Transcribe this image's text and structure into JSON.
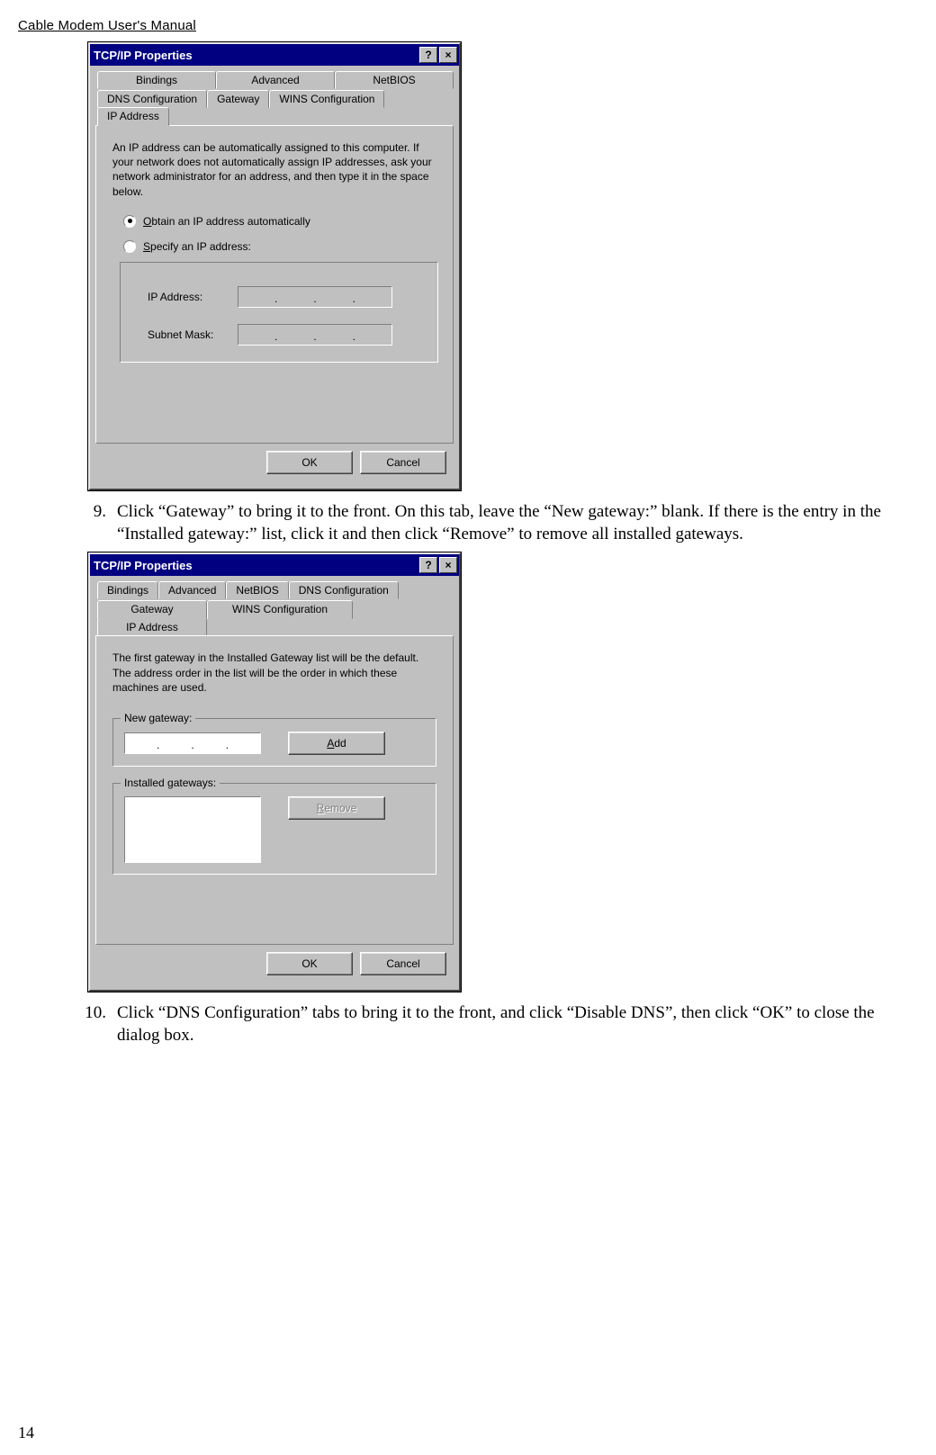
{
  "header": {
    "running_head": "Cable Modem User's Manual"
  },
  "page_number": "14",
  "dlg1": {
    "title": "TCP/IP Properties",
    "help_btn": "?",
    "close_btn": "×",
    "tabs_row1": {
      "bindings": "Bindings",
      "advanced": "Advanced",
      "netbios": "NetBIOS"
    },
    "tabs_row2": {
      "dns": "DNS Configuration",
      "gateway": "Gateway",
      "wins": "WINS Configuration",
      "ip": "IP Address"
    },
    "help_text": "An IP address can be automatically assigned to this computer. If your network does not automatically assign IP addresses, ask your network administrator for an address, and then type it in the space below.",
    "radio_auto_prefix": "O",
    "radio_auto_label": "btain an IP address automatically",
    "radio_spec_prefix": "S",
    "radio_spec_label": "pecify an IP address:",
    "ip_label": "IP Address:",
    "mask_label": "Subnet Mask:",
    "ok": "OK",
    "cancel": "Cancel"
  },
  "step9": {
    "num": "9.",
    "text": "Click “Gateway” to bring it to the front. On this tab, leave the “New gateway:” blank. If there is the entry in the “Installed gateway:” list, click it and then click “Remove” to remove all installed gateways."
  },
  "dlg2": {
    "title": "TCP/IP Properties",
    "help_btn": "?",
    "close_btn": "×",
    "tabs_row1": {
      "bindings": "Bindings",
      "advanced": "Advanced",
      "netbios": "NetBIOS",
      "dns": "DNS Configuration"
    },
    "tabs_row2": {
      "gateway": "Gateway",
      "wins": "WINS Configuration",
      "ip": "IP Address"
    },
    "help_text": "The first gateway in the Installed Gateway list will be the default. The address order in the list will be the order in which these machines are used.",
    "new_gw_legend": "New gateway:",
    "add_u": "A",
    "add_rest": "dd",
    "inst_gw_legend": "Installed gateways:",
    "remove_u": "R",
    "remove_rest": "emove",
    "ok": "OK",
    "cancel": "Cancel"
  },
  "step10": {
    "num": "10.",
    "text": "Click “DNS Configuration” tabs to bring it to the front, and click “Disable DNS”, then click “OK” to close the dialog box."
  }
}
